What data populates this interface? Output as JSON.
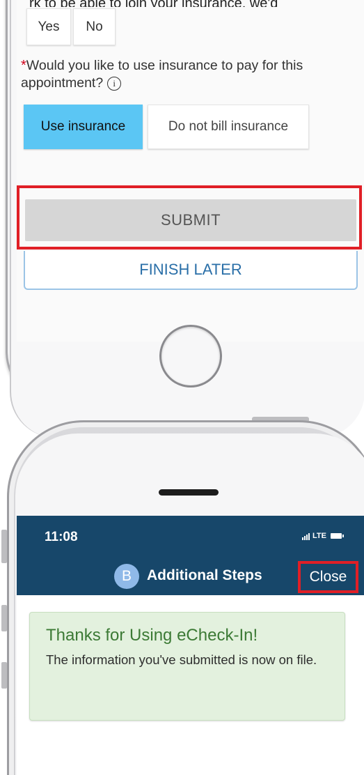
{
  "top_screen": {
    "top_text_fragment": "rk to be able to join your insurance, we'd",
    "yes_label": "Yes",
    "no_label": "No",
    "question_required_mark": "*",
    "question_text": "Would you like to use insurance to pay for this appointment?",
    "info_icon_glyph": "i",
    "use_insurance_label": "Use insurance",
    "do_not_bill_label": "Do not bill insurance",
    "submit_label": "SUBMIT",
    "finish_later_label": "FINISH LATER"
  },
  "bottom_screen": {
    "status_time": "11:08",
    "status_network": "LTE",
    "nav_avatar_letter": "B",
    "nav_title": "Additional Steps",
    "close_label": "Close",
    "success_title": "Thanks for Using eCheck-In!",
    "success_message": "The information you've submitted is now on file."
  },
  "colors": {
    "nav_bar": "#17476a",
    "selected_option": "#5bc6f4",
    "highlight_box": "#e01f26",
    "success_bg": "#e3f1de",
    "success_title": "#3c7a35",
    "finish_later_text": "#2a6fa8"
  },
  "icons": {
    "info": "info-icon",
    "home_button": "home-button",
    "signal": "signal-bars-icon",
    "battery": "battery-icon",
    "avatar": "avatar"
  }
}
